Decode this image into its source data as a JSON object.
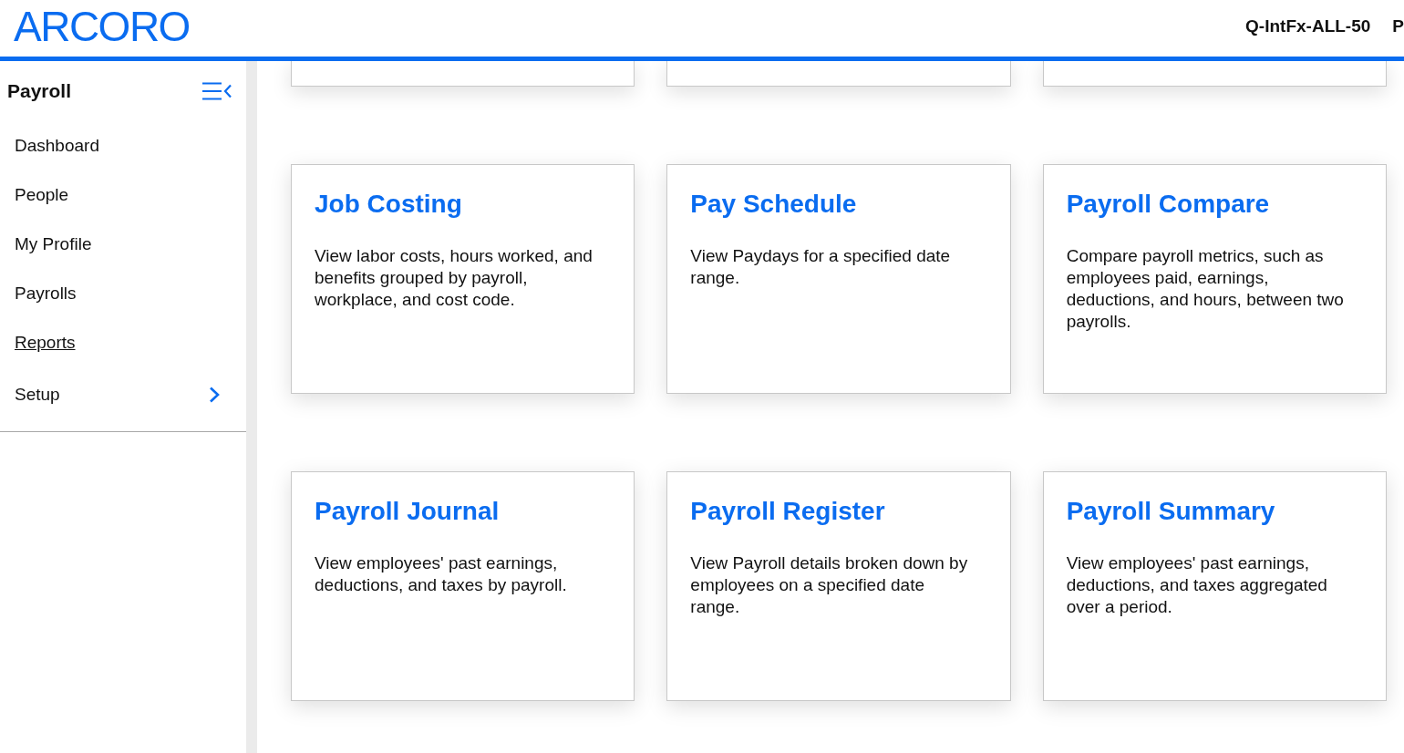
{
  "header": {
    "logo": "ARCORO",
    "labels": [
      "Q-IntFx-ALL-50",
      "P"
    ]
  },
  "sidebar": {
    "title": "Payroll",
    "items": [
      {
        "label": "Dashboard",
        "selected": false,
        "has_submenu": false
      },
      {
        "label": "People",
        "selected": false,
        "has_submenu": false
      },
      {
        "label": "My Profile",
        "selected": false,
        "has_submenu": false
      },
      {
        "label": "Payrolls",
        "selected": false,
        "has_submenu": false
      },
      {
        "label": "Reports",
        "selected": true,
        "has_submenu": false
      },
      {
        "label": "Setup",
        "selected": false,
        "has_submenu": true
      }
    ]
  },
  "reports": {
    "cards": [
      {
        "title": "Job Costing",
        "description": "View labor costs, hours worked, and benefits grouped by payroll, workplace, and cost code."
      },
      {
        "title": "Pay Schedule",
        "description": "View Paydays for a specified date range."
      },
      {
        "title": "Payroll Compare",
        "description": "Compare payroll metrics, such as employees paid, earnings, deductions, and hours, between two payrolls."
      },
      {
        "title": "Payroll Journal",
        "description": "View employees' past earnings, deductions, and taxes by payroll."
      },
      {
        "title": "Payroll Register",
        "description": "View Payroll details broken down by employees on a specified date range."
      },
      {
        "title": "Payroll Summary",
        "description": "View employees' past earnings, deductions, and taxes aggregated over a period."
      }
    ]
  }
}
